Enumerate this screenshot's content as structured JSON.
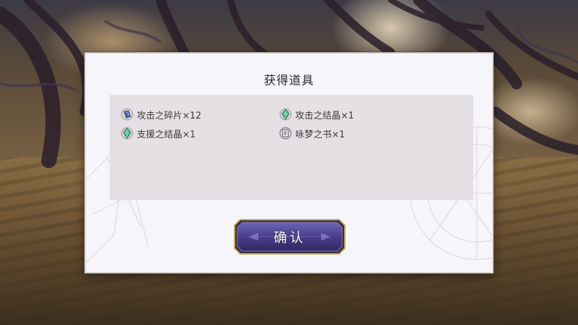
{
  "dialog": {
    "title": "获得道具",
    "items": [
      {
        "label": "攻击之碎片×12",
        "icon": "blue-shard-icon"
      },
      {
        "label": "攻击之结晶×1",
        "icon": "green-crystal-icon"
      },
      {
        "label": "支援之结晶×1",
        "icon": "green-crystal-icon"
      },
      {
        "label": "咏梦之书×1",
        "icon": "book-icon"
      }
    ],
    "confirm_label": "确认"
  },
  "colors": {
    "dialog_bg": "#f6f5f9",
    "panel_bg": "#e4e0e4",
    "button_fill": "#4a3f88",
    "button_border": "#c9a85a",
    "crystal_green": "#4fbf8f",
    "shard_blue": "#5566a8"
  }
}
